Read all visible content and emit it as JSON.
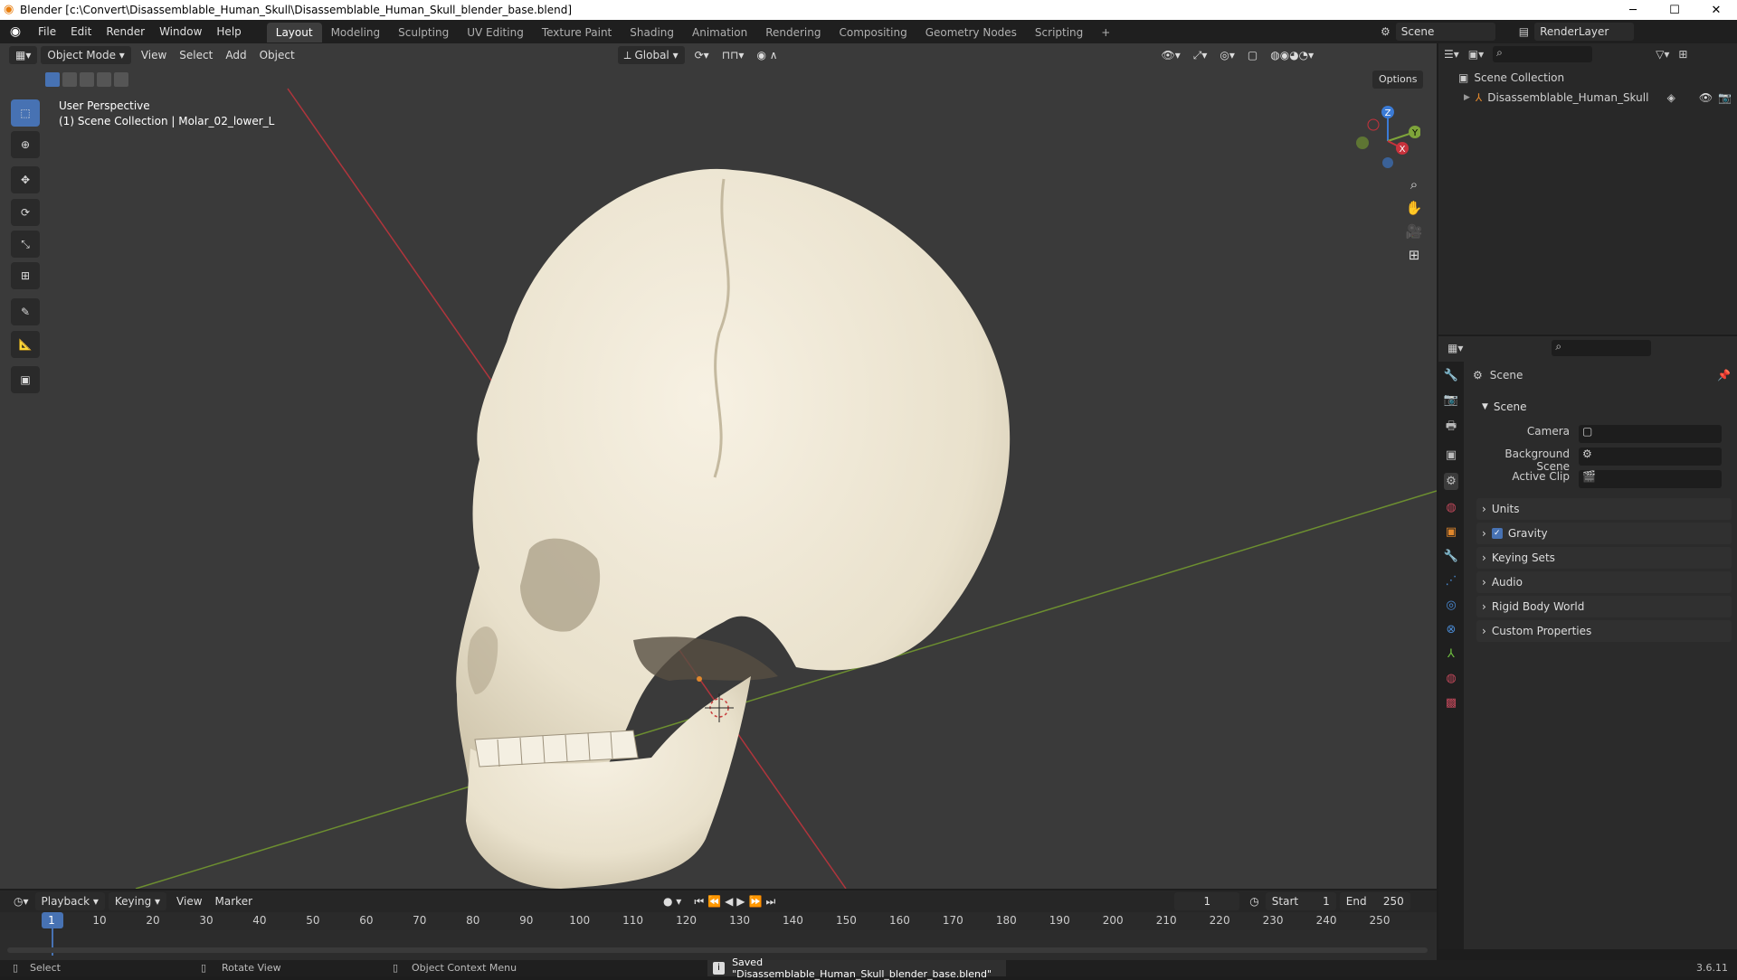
{
  "window": {
    "title": "Blender [c:\\Convert\\Disassemblable_Human_Skull\\Disassemblable_Human_Skull_blender_base.blend]",
    "min": "─",
    "max": "☐",
    "close": "✕"
  },
  "menu": [
    "File",
    "Edit",
    "Render",
    "Window",
    "Help"
  ],
  "workspaces": [
    "Layout",
    "Modeling",
    "Sculpting",
    "UV Editing",
    "Texture Paint",
    "Shading",
    "Animation",
    "Rendering",
    "Compositing",
    "Geometry Nodes",
    "Scripting",
    "+"
  ],
  "scene_selector": {
    "scene": "Scene",
    "view_layer": "RenderLayer"
  },
  "viewport": {
    "mode": "Object Mode",
    "menus": [
      "View",
      "Select",
      "Add",
      "Object"
    ],
    "transform_orientation": "Global",
    "options": "Options",
    "info_line1": "User Perspective",
    "info_line2": "(1) Scene Collection | Molar_02_lower_L",
    "gizmo": {
      "z": "Z",
      "y": "Y",
      "x": "X"
    }
  },
  "outliner": {
    "root": "Scene Collection",
    "items": [
      {
        "name": "Disassemblable_Human_Skull"
      }
    ]
  },
  "properties": {
    "header": "Scene",
    "panel_title": "Scene",
    "camera_label": "Camera",
    "background_scene_label": "Background Scene",
    "active_clip_label": "Active Clip",
    "sections": [
      "Units",
      "Gravity",
      "Keying Sets",
      "Audio",
      "Rigid Body World",
      "Custom Properties"
    ],
    "gravity_checked": true
  },
  "timeline": {
    "menus": [
      "Playback",
      "Keying",
      "View",
      "Marker"
    ],
    "current_frame": "1",
    "start_label": "Start",
    "start": "1",
    "end_label": "End",
    "end": "250",
    "ticks": [
      "1",
      "10",
      "20",
      "30",
      "40",
      "50",
      "60",
      "70",
      "80",
      "90",
      "100",
      "110",
      "120",
      "130",
      "140",
      "150",
      "160",
      "170",
      "180",
      "190",
      "200",
      "210",
      "220",
      "230",
      "240",
      "250"
    ]
  },
  "status": {
    "select": "Select",
    "rotate": "Rotate View",
    "context": "Object Context Menu",
    "message": "Saved \"Disassemblable_Human_Skull_blender_base.blend\"",
    "version": "3.6.11"
  },
  "colors": {
    "accent": "#4772b3",
    "x_axis": "#c8323c",
    "y_axis": "#7ea43a",
    "bone": "#eee7d6"
  }
}
